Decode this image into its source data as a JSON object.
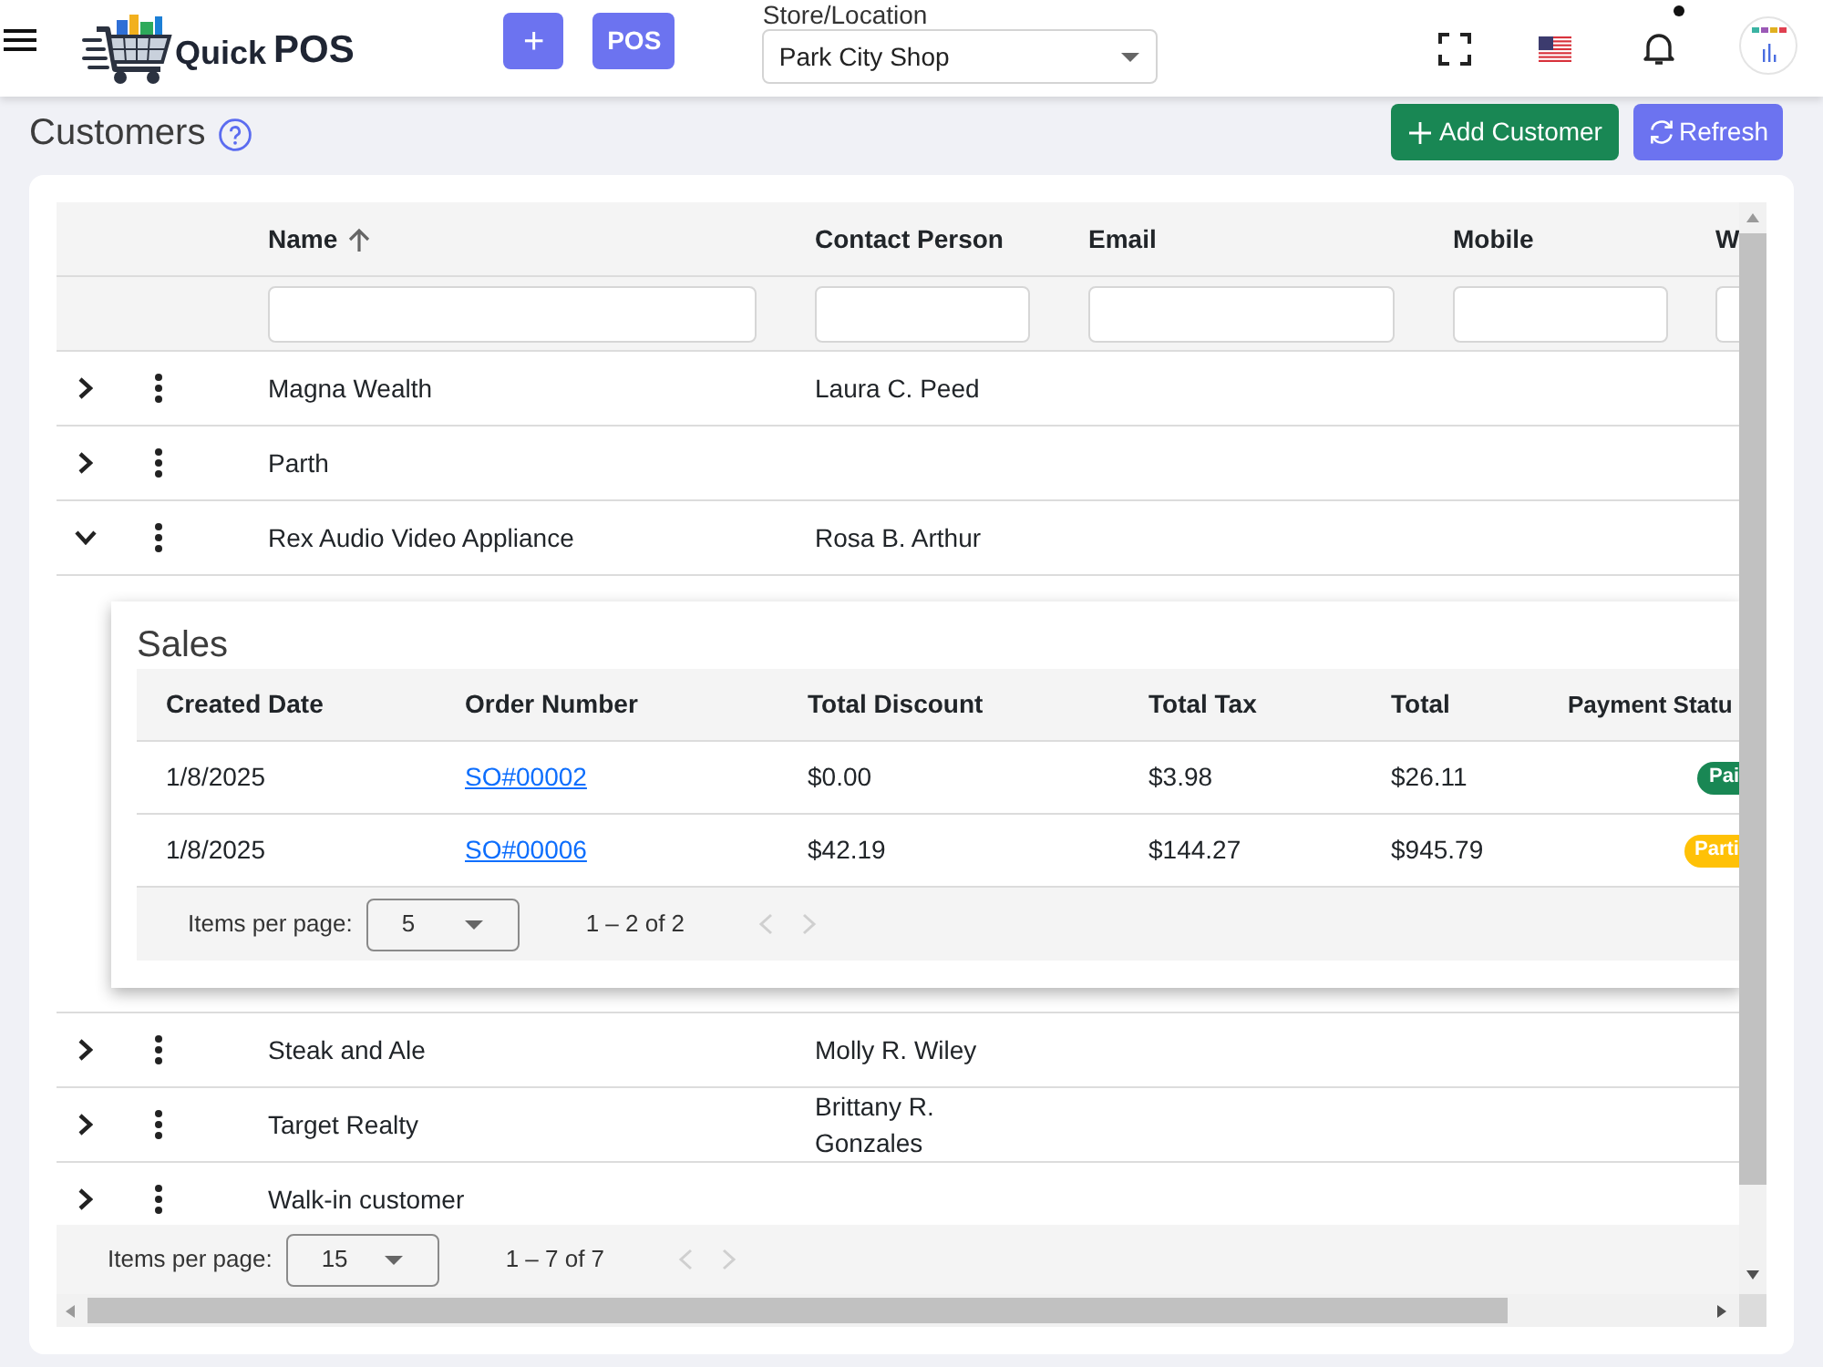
{
  "header": {
    "brand": [
      "Quick",
      "POS"
    ],
    "quick_add_button": "+",
    "pos_button": "POS",
    "store_location": {
      "label": "Store/Location",
      "value": "Park City Shop"
    },
    "notifications": {
      "unread": true
    }
  },
  "page": {
    "title": "Customers",
    "actions": [
      {
        "kind": "add",
        "label": "Add Customer"
      },
      {
        "kind": "refresh",
        "label": "Refresh"
      }
    ]
  },
  "table": {
    "columns": [
      {
        "label": "Name",
        "sorted_ascending": true
      },
      {
        "label": "Contact Person"
      },
      {
        "label": "Email"
      },
      {
        "label": "Mobile"
      },
      {
        "label": "W"
      }
    ],
    "rows": [
      {
        "name": "Magna Wealth",
        "contact_person": "Laura C. Peed",
        "expanded": false
      },
      {
        "name": "Parth",
        "expanded": false
      },
      {
        "name": "Rex Audio Video Appliance",
        "contact_person": "Rosa B. Arthur",
        "expanded": true,
        "sales": {
          "title": "Sales",
          "columns": [
            "Created Date",
            "Order Number",
            "Total Discount",
            "Total Tax",
            "Total",
            "Payment Statu"
          ],
          "rows": [
            {
              "created_date": "1/8/2025",
              "order_number": "SO#00002",
              "total_discount": "$0.00",
              "total_tax": "$3.98",
              "total": "$26.11",
              "payment_status": {
                "label": "Pai",
                "color": "#198754"
              }
            },
            {
              "created_date": "1/8/2025",
              "order_number": "SO#00006",
              "total_discount": "$42.19",
              "total_tax": "$144.27",
              "total": "$945.79",
              "payment_status": {
                "label": "Parti",
                "color": "#ffc107"
              }
            }
          ],
          "pagination": {
            "label": "Items per page:",
            "page_size": "5",
            "range": "1 – 2 of 2",
            "previous_disabled": true,
            "next_disabled": true
          }
        }
      },
      {
        "name": "Steak and Ale",
        "contact_person": "Molly R. Wiley",
        "expanded": false
      },
      {
        "name": "Target Realty",
        "contact_person": "Brittany R. Gonzales",
        "expanded": false
      },
      {
        "name": "Walk-in customer",
        "expanded": false
      }
    ],
    "pagination": {
      "label": "Items per page:",
      "page_size": "15",
      "range": "1 – 7 of 7",
      "previous_disabled": true,
      "next_disabled": true
    }
  }
}
